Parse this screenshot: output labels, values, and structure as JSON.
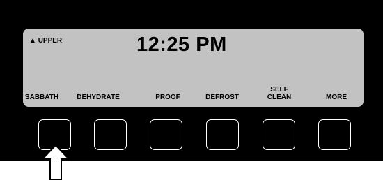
{
  "display": {
    "indicator_icon": "up-triangle-icon",
    "indicator_glyph": "▲",
    "indicator_label": "UPPER",
    "time": "12:25 PM"
  },
  "soft_keys": [
    {
      "label": "SABBATH"
    },
    {
      "label": "DEHYDRATE"
    },
    {
      "label": "PROOF"
    },
    {
      "label": "DEFROST"
    },
    {
      "label": "SELF\nCLEAN"
    },
    {
      "label": "MORE"
    }
  ],
  "pointer": {
    "icon": "up-arrow-icon",
    "target": "SABBATH"
  },
  "colors": {
    "panel": "#000000",
    "lcd": "#c2c2c2",
    "key_border": "#ffffff",
    "arrow_fill": "#ffffff",
    "arrow_stroke": "#000000"
  }
}
